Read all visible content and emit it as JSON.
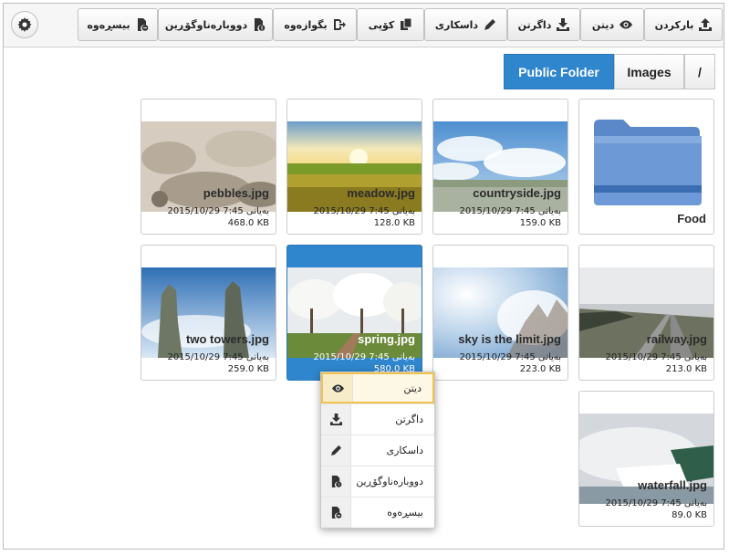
{
  "toolbar": {
    "settings_icon": "gear-icon",
    "buttons": [
      {
        "label": "بیسڕەوە",
        "icon": "delete-file-icon"
      },
      {
        "label": "دووبارەناوگۆڕین",
        "icon": "rename-file-icon"
      },
      {
        "label": "بگوازەوە",
        "icon": "move-icon"
      },
      {
        "label": "کۆپی",
        "icon": "copy-icon"
      },
      {
        "label": "داسکاری",
        "icon": "pencil-icon"
      },
      {
        "label": "داگرتن",
        "icon": "download-icon"
      },
      {
        "label": "دیتن",
        "icon": "eye-icon"
      },
      {
        "label": "بارکردن",
        "icon": "upload-icon"
      }
    ]
  },
  "breadcrumb": {
    "items": [
      "Public Folder",
      "Images",
      "/"
    ],
    "active": "Public Folder"
  },
  "files": [
    {
      "name": "Food",
      "type": "folder"
    },
    {
      "name": "countryside.jpg",
      "date": "2015/10/29 7:45 بەیانی",
      "size": "159.0 KB"
    },
    {
      "name": "meadow.jpg",
      "date": "2015/10/29 7:45 بەیانی",
      "size": "128.0 KB"
    },
    {
      "name": "pebbles.jpg",
      "date": "2015/10/29 7:45 بەیانی",
      "size": "468.0 KB"
    },
    {
      "name": "railway.jpg",
      "date": "2015/10/29 7:45 بەیانی",
      "size": "213.0 KB"
    },
    {
      "name": "sky is the limit.jpg",
      "date": "2015/10/29 7:45 بەیانی",
      "size": "223.0 KB"
    },
    {
      "name": "spring.jpg",
      "date": "2015/10/29 7:45 بەیانی",
      "size": "580.0 KB",
      "selected": true
    },
    {
      "name": "two towers.jpg",
      "date": "2015/10/29 7:45 بەیانی",
      "size": "259.0 KB"
    },
    {
      "name": "waterfall.jpg",
      "date": "2015/10/29 7:45 بەیانی",
      "size": "89.0 KB"
    }
  ],
  "context_menu": {
    "items": [
      {
        "label": "دیتن",
        "icon": "eye-icon",
        "highlighted": true
      },
      {
        "label": "داگرتن",
        "icon": "download-icon"
      },
      {
        "label": "داسکاری",
        "icon": "pencil-icon"
      },
      {
        "label": "دووبارەناوگۆڕین",
        "icon": "rename-file-icon"
      },
      {
        "label": "بیسڕەوە",
        "icon": "delete-file-icon"
      }
    ]
  },
  "colors": {
    "accent": "#2f86cd",
    "highlight_border": "#f0c34e"
  }
}
